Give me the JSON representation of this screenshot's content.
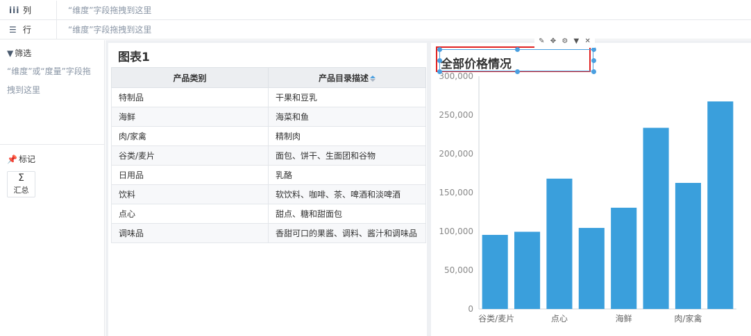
{
  "shelves": {
    "columns": {
      "label": "列",
      "hint": "“维度”字段拖拽到这里",
      "icon": "columns-icon"
    },
    "rows": {
      "label": "行",
      "hint": "“维度”字段拖拽到这里",
      "icon": "rows-list-icon"
    }
  },
  "left_panel": {
    "filter_title": "筛选",
    "filter_hint": "“维度”或“度量”字段拖拽到这里",
    "mark_title": "标记",
    "summary_button": {
      "symbol": "Σ",
      "label": "汇总"
    }
  },
  "table_widget": {
    "title": "图表1",
    "headers": [
      "产品类别",
      "产品目录描述"
    ],
    "rows": [
      [
        "特制品",
        "干果和豆乳"
      ],
      [
        "海鲜",
        "海菜和鱼"
      ],
      [
        "肉/家禽",
        "精制肉"
      ],
      [
        "谷类/麦片",
        "面包、饼干、生面团和谷物"
      ],
      [
        "日用品",
        "乳酪"
      ],
      [
        "饮料",
        "软饮料、咖啡、茶、啤酒和淡啤酒"
      ],
      [
        "点心",
        "甜点、糖和甜面包"
      ],
      [
        "调味品",
        "香甜可口的果酱、调料、酱汁和调味品"
      ]
    ]
  },
  "chart_widget": {
    "toolbar": [
      "edit-icon",
      "move-icon",
      "settings-icon",
      "dropdown-icon",
      "close-icon"
    ],
    "colors": {
      "bar": "#3a9fdc",
      "selection": "#e02020",
      "handle": "#4a9fe0"
    }
  },
  "chart_data": {
    "type": "bar",
    "title": "全部价格情况",
    "categories": [
      "谷类/麦片",
      "",
      "点心",
      "",
      "海鲜",
      "",
      "肉/家禽",
      ""
    ],
    "values": [
      95500,
      99500,
      168000,
      104500,
      130500,
      233500,
      162500,
      267500
    ],
    "ylim": [
      0,
      300000
    ],
    "yticks": [
      "0",
      "50,000",
      "100,000",
      "150,000",
      "200,000",
      "250,000",
      "300,000"
    ],
    "grid": false
  }
}
